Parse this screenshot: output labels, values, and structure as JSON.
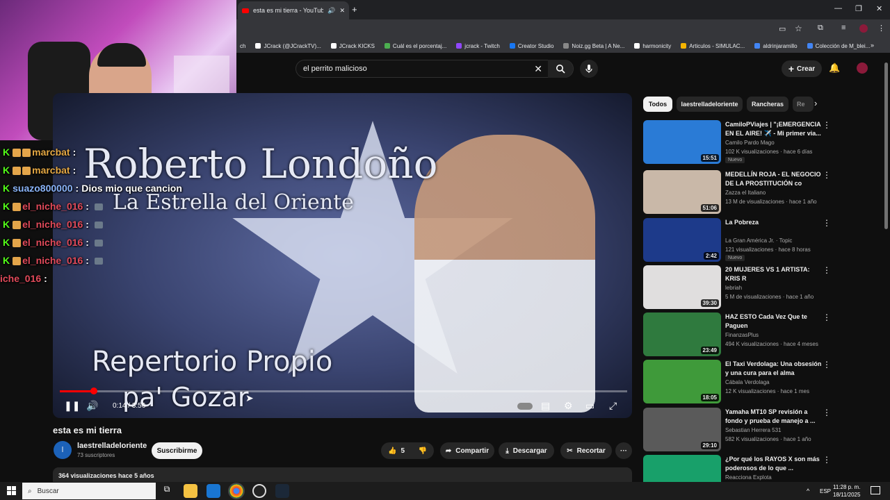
{
  "browser": {
    "tab_title": "esta es mi tierra - YouTube",
    "bookmarks": [
      "ch",
      "JCrack (@JCrackTV)...",
      "JCrack KICKS",
      "Cuál es el porcentaj...",
      "jcrack - Twitch",
      "Creator Studio",
      "Noiz.gg Beta | A Ne...",
      "harmonicity",
      "Articulos - SIMULAC...",
      "aldrinjaramillo",
      "Colección de M_blei..."
    ],
    "bookmark_colors": [
      "#888",
      "#fff",
      "#fff",
      "#4caf50",
      "#9147ff",
      "#1877f2",
      "#888",
      "#fff",
      "#f5b400",
      "#4285f4",
      "#4285f4"
    ]
  },
  "youtube": {
    "search_query": "el perrito malicioso",
    "create_label": "Crear"
  },
  "chat": [
    {
      "user": "marcbat",
      "sep": ":",
      "text": "",
      "color": "#e5a843",
      "badges": 2
    },
    {
      "user": "marcbat",
      "sep": ":",
      "text": "",
      "color": "#e5a843",
      "badges": 2
    },
    {
      "user": "suazo800000",
      "sep": ":",
      "text": "Dios mio que cancion",
      "color": "#8ab4f8",
      "badges": 0
    },
    {
      "user": "el_niche_016",
      "sep": ":",
      "text": "",
      "color": "#e14a5a",
      "badges": 1
    },
    {
      "user": "el_niche_016",
      "sep": ":",
      "text": "",
      "color": "#e14a5a",
      "badges": 1
    },
    {
      "user": "el_niche_016",
      "sep": ":",
      "text": "",
      "color": "#e14a5a",
      "badges": 1
    },
    {
      "user": "el_niche_016",
      "sep": ":",
      "text": "",
      "color": "#e14a5a",
      "badges": 1
    },
    {
      "user": "iche_016",
      "sep": ":",
      "text": "",
      "color": "#e14a5a",
      "badges": 0
    }
  ],
  "video": {
    "overlay_line1": "Roberto Londoño",
    "overlay_line2": "La Estrella del Oriente",
    "overlay_line3": "Repertorio Propio",
    "overlay_line4": "pa' Gozar",
    "time": "0:14 / 3:56",
    "progress": 0.06,
    "title": "esta es mi tierra",
    "channel": "laestrelladeloriente",
    "channel_initial": "l",
    "subscribers": "73 suscriptores",
    "subscribe_label": "Suscribirme",
    "likes": "5",
    "share_label": "Compartir",
    "download_label": "Descargar",
    "clip_label": "Recortar",
    "description": "364 visualizaciones  hace 5 años"
  },
  "chips": [
    "Todos",
    "laestrelladeloriente",
    "Rancheras",
    "Re"
  ],
  "recommendations": [
    {
      "title": "CamiloPViajes | \"¡EMERGENCIA EN EL AIRE! ✈️ - Mi primer via...",
      "channel": "Camilo Pardo Mago",
      "meta": "102 K visualizaciones · hace 6 días",
      "duration": "15:51",
      "badge": "Nuevo",
      "thumb": "#2a7bd6"
    },
    {
      "title": "MEDELLÍN ROJA - EL NEGOCIO DE LA PROSTITUCIÓN co",
      "channel": "Zazza el Italiano",
      "meta": "13 M de visualizaciones · hace 1 año",
      "duration": "51:06",
      "badge": "",
      "thumb": "#c9b8a8"
    },
    {
      "title": "La Pobreza",
      "channel": "La Gran América Jr. · Topic",
      "meta": "121 visualizaciones · hace 8 horas",
      "duration": "2:42",
      "badge": "Nuevo",
      "thumb": "#1d3a8a"
    },
    {
      "title": "20 MUJERES VS 1 ARTISTA: KRIS R",
      "channel": "lebriah",
      "meta": "5 M de visualizaciones · hace 1 año",
      "duration": "39:30",
      "badge": "",
      "thumb": "#e0dede"
    },
    {
      "title": "HAZ ESTO Cada Vez Que te Paguen",
      "channel": "FinanzasPlus",
      "meta": "494 K visualizaciones · hace 4 meses",
      "duration": "23:49",
      "badge": "",
      "thumb": "#2f7a3e"
    },
    {
      "title": "El Taxi Verdolaga: Una obsesión y una cura para el alma",
      "channel": "Cábala Verdolaga",
      "meta": "12 K visualizaciones · hace 1 mes",
      "duration": "18:05",
      "badge": "",
      "thumb": "#3f9a3a"
    },
    {
      "title": "Yamaha MT10 SP revisión a fondo y prueba de manejo a ...",
      "channel": "Sebastian Herrera 531",
      "meta": "582 K visualizaciones · hace 1 año",
      "duration": "29:10",
      "badge": "",
      "thumb": "#5a5a5a"
    },
    {
      "title": "¿Por qué los RAYOS X son más poderosos de lo que ...",
      "channel": "Reacciona Explota",
      "meta": "",
      "duration": "",
      "badge": "",
      "thumb": "#18a06a"
    }
  ],
  "taskbar": {
    "search_label": "Buscar",
    "lang": "ESP",
    "time": "11:28 p. m.",
    "date": "18/11/2025"
  }
}
